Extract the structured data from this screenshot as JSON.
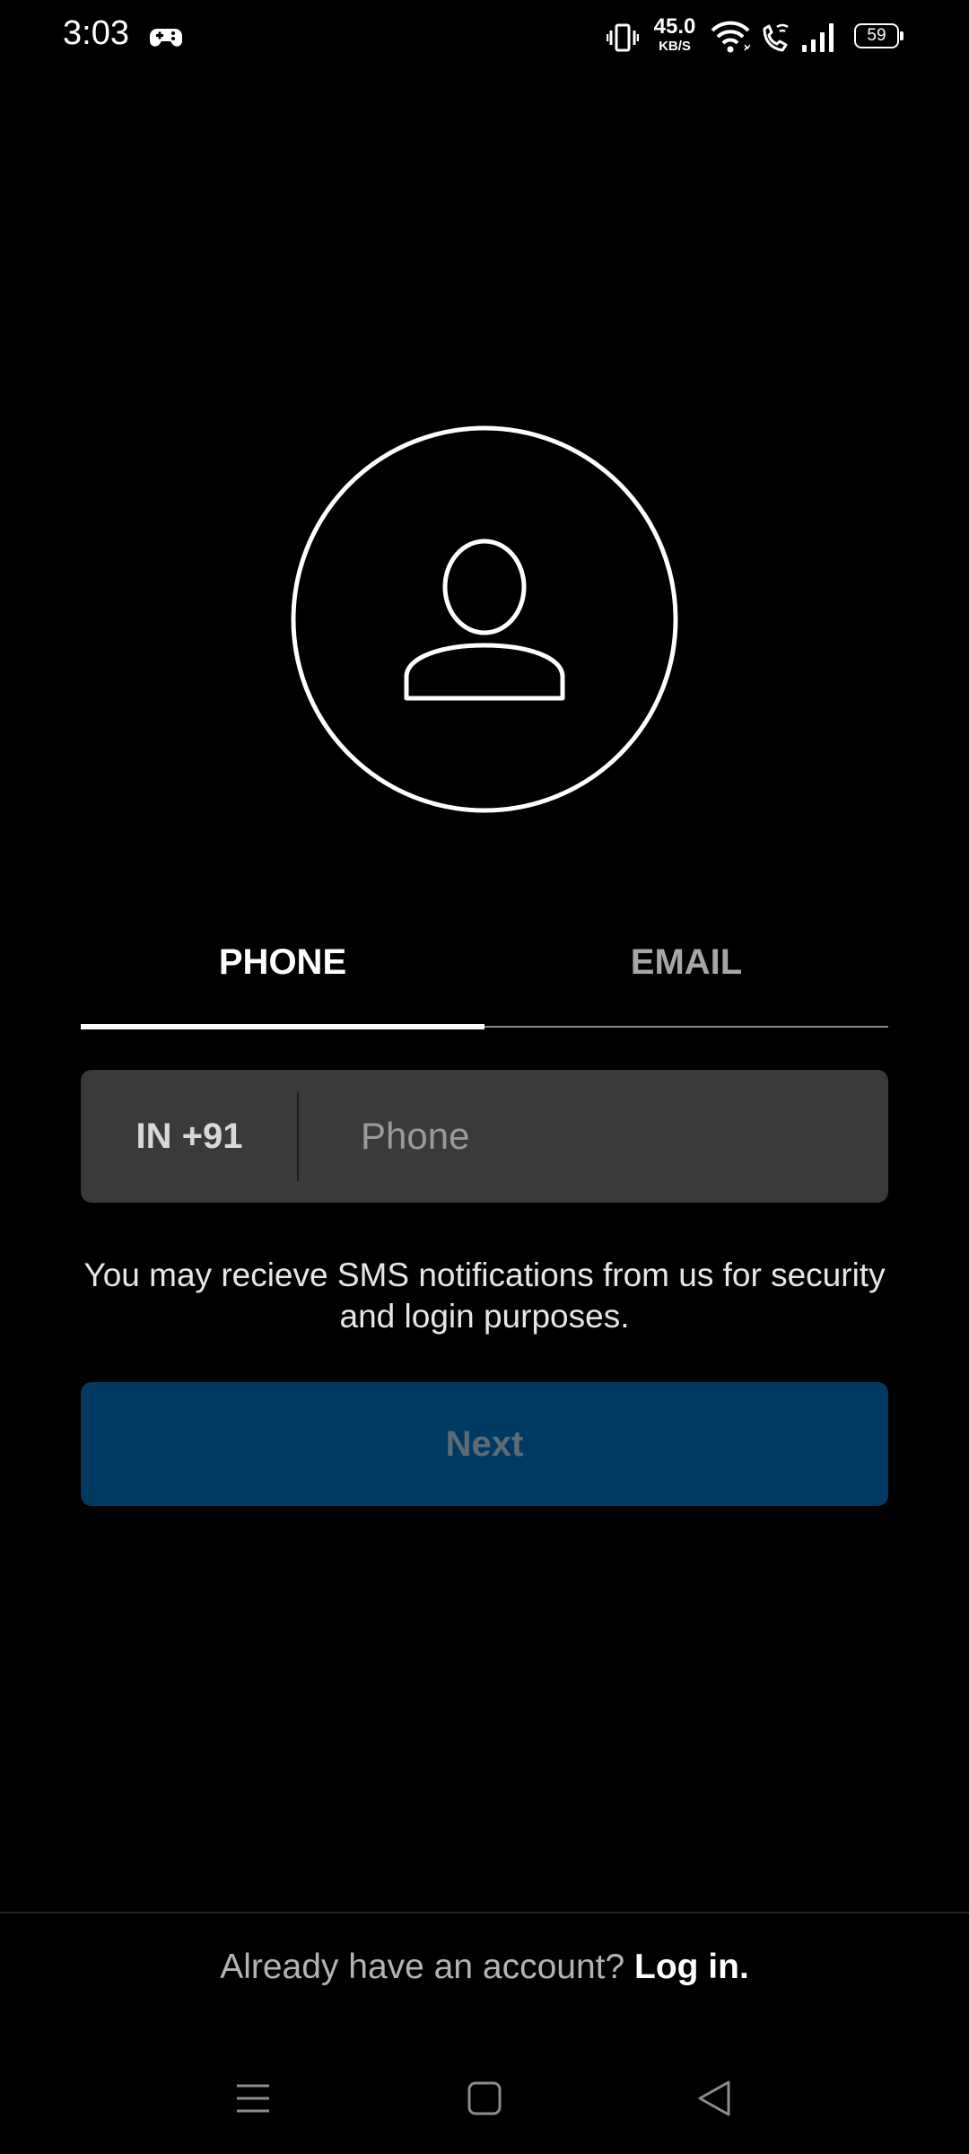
{
  "status_bar": {
    "time": "3:03",
    "network_speed_value": "45.0",
    "network_speed_unit": "KB/S",
    "battery_level": "59",
    "icons": [
      "game-controller-icon",
      "vibrate-icon",
      "wifi-icon",
      "wifi-calling-icon",
      "signal-icon",
      "battery-icon"
    ]
  },
  "avatar": {
    "icon": "user-profile-icon"
  },
  "tabs": [
    {
      "label": "PHONE",
      "active": true
    },
    {
      "label": "EMAIL",
      "active": false
    }
  ],
  "phone_form": {
    "country_code": "IN +91",
    "phone_placeholder": "Phone",
    "phone_value": ""
  },
  "sms_notice": "You may recieve SMS notifications from us for security and login purposes.",
  "next_button": {
    "label": "Next",
    "enabled": false
  },
  "footer": {
    "prompt": "Already have an account? ",
    "login_link": "Log in."
  },
  "navigation_bar": {
    "icons": [
      "menu-icon",
      "home-icon",
      "back-icon"
    ]
  },
  "colors": {
    "background": "#000000",
    "input_background": "#3a3a3a",
    "button_background": "#003a63",
    "button_text_disabled": "#5e6b75",
    "active_tab": "#ffffff",
    "inactive_tab": "#a6a6a6"
  }
}
